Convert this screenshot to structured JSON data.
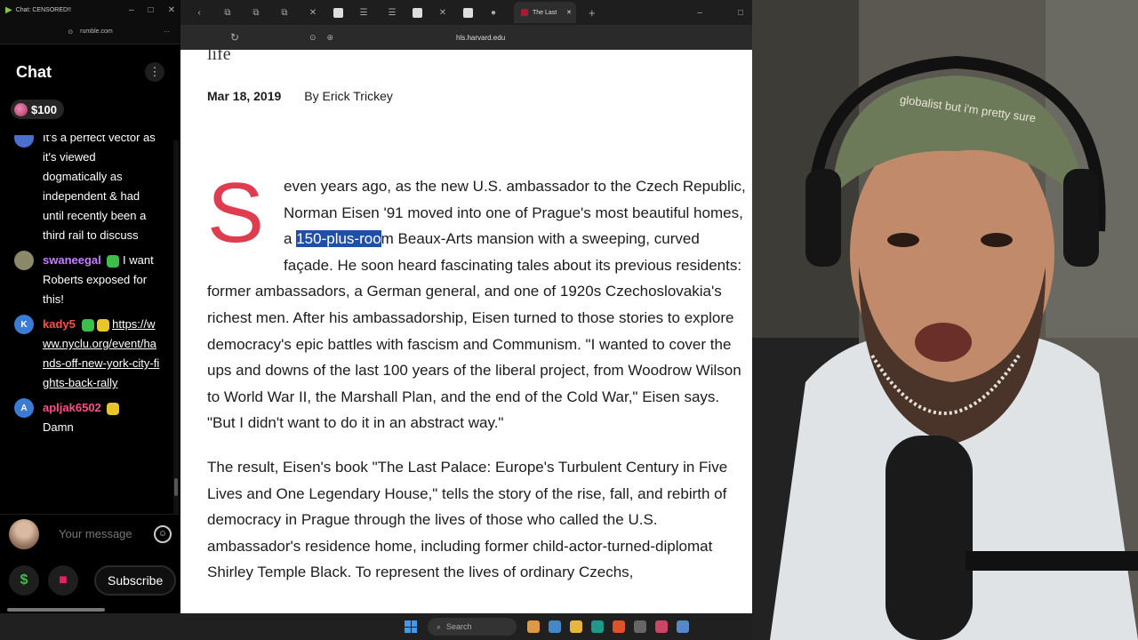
{
  "chat_window": {
    "title": "Chat: CENSORED!!",
    "url": "rumble.com",
    "header_title": "Chat",
    "donation_amount": "$100",
    "messages": [
      {
        "user": "",
        "avatar_letter": "",
        "avatar_color": "#4a6fd0",
        "text": "It's a perfect vector as it's viewed dogmatically as independent & had until recently been a third rail to discuss",
        "user_color": "#8aa8ff"
      },
      {
        "user": "swaneegal",
        "avatar_letter": "",
        "avatar_color": "#8a8a6a",
        "text": "I want Roberts exposed for this!",
        "user_color": "#c77dff"
      },
      {
        "user": "kady5",
        "avatar_letter": "K",
        "avatar_color": "#3a7bd5",
        "text": "https://www.nyclu.org/event/hands-off-new-york-city-fights-back-rally",
        "user_color": "#ff4d4d"
      },
      {
        "user": "apljak6502",
        "avatar_letter": "A",
        "avatar_color": "#3a7bd5",
        "text": "Damn",
        "user_color": "#ff4d8a"
      }
    ],
    "input_placeholder": "Your message",
    "subscribe_label": "Subscribe"
  },
  "browser": {
    "active_tab_title": "The Last",
    "url": "hls.harvard.edu",
    "article": {
      "top_word": "life",
      "date": "Mar 18, 2019",
      "author": "By Erick Trickey",
      "dropcap": "S",
      "p1_before": "even years ago, as the new U.S. ambassador to the Czech Republic, Norman Eisen '91 moved into one of Prague's most beautiful homes, a ",
      "p1_highlight": "150-plus-roo",
      "p1_after": "m Beaux-Arts mansion with a sweeping, curved façade. He soon heard fascinating tales about its previous residents: former ambassadors, a German general, and one of 1920s Czechoslovakia's richest men. After his ambassadorship, Eisen turned to those stories to explore democracy's epic battles with fascism and Communism. \"I wanted to cover the ups and downs of the last 100 years of the liberal project, from Woodrow Wilson to World War II, the Marshall Plan, and the end of the Cold War,\" Eisen says. \"But I didn't want to do it in an abstract way.\"",
      "p2": "The result, Eisen's book \"The Last Palace: Europe's Turbulent Century in Five Lives and One Legendary House,\" tells the story of the rise, fall, and rebirth of democracy in Prague through the lives of those who called the U.S. ambassador's residence home, including former child-actor-turned-diplomat Shirley Temple Black. To represent the lives of ordinary Czechs,"
    }
  },
  "taskbar": {
    "search_label": "Search"
  },
  "webcam": {
    "cap_text": "globalist but i'm pretty sure"
  }
}
